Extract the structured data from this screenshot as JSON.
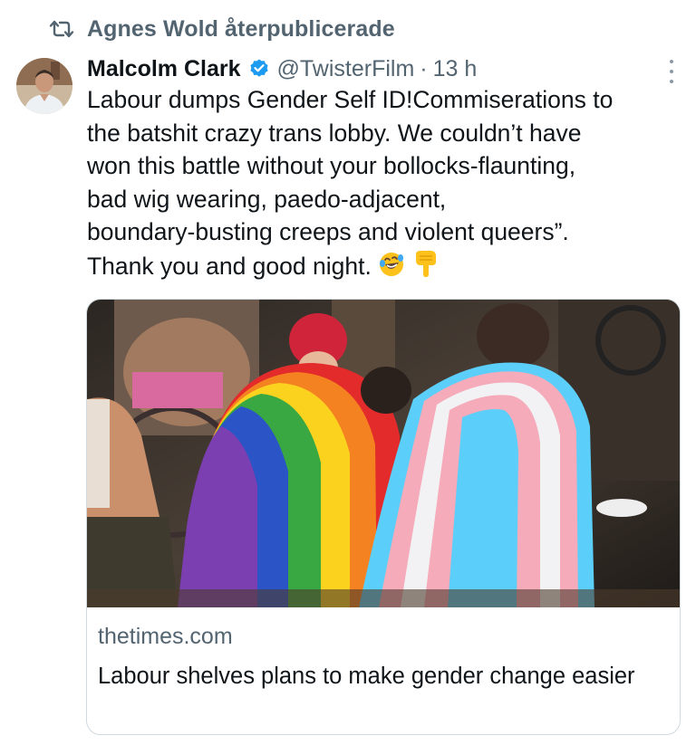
{
  "repost": {
    "label": "Agnes Wold återpublicerade"
  },
  "tweet": {
    "author": "Malcolm Clark",
    "handle": "@TwisterFilm",
    "separator": "·",
    "time": "13 h",
    "lines": [
      "Labour dumps Gender Self ID!Commiserations to",
      "the batshit crazy trans lobby. We couldn’t have",
      "won this battle without your bollocks-flaunting,",
      "bad wig wearing, paedo-adjacent,",
      "boundary-busting creeps and violent  queers”.",
      "Thank you and good night."
    ],
    "emojis": [
      "rofl-emoji",
      "pointing-down-emoji"
    ]
  },
  "card": {
    "domain": "thetimes.com",
    "title": "Labour shelves plans to make gender change easier",
    "image_alt_icon": "photo-pride-and-trans-flags"
  },
  "colors": {
    "text": "#0f1419",
    "secondary": "#536471",
    "verified": "#1d9bf0",
    "border": "#cfd9de"
  }
}
